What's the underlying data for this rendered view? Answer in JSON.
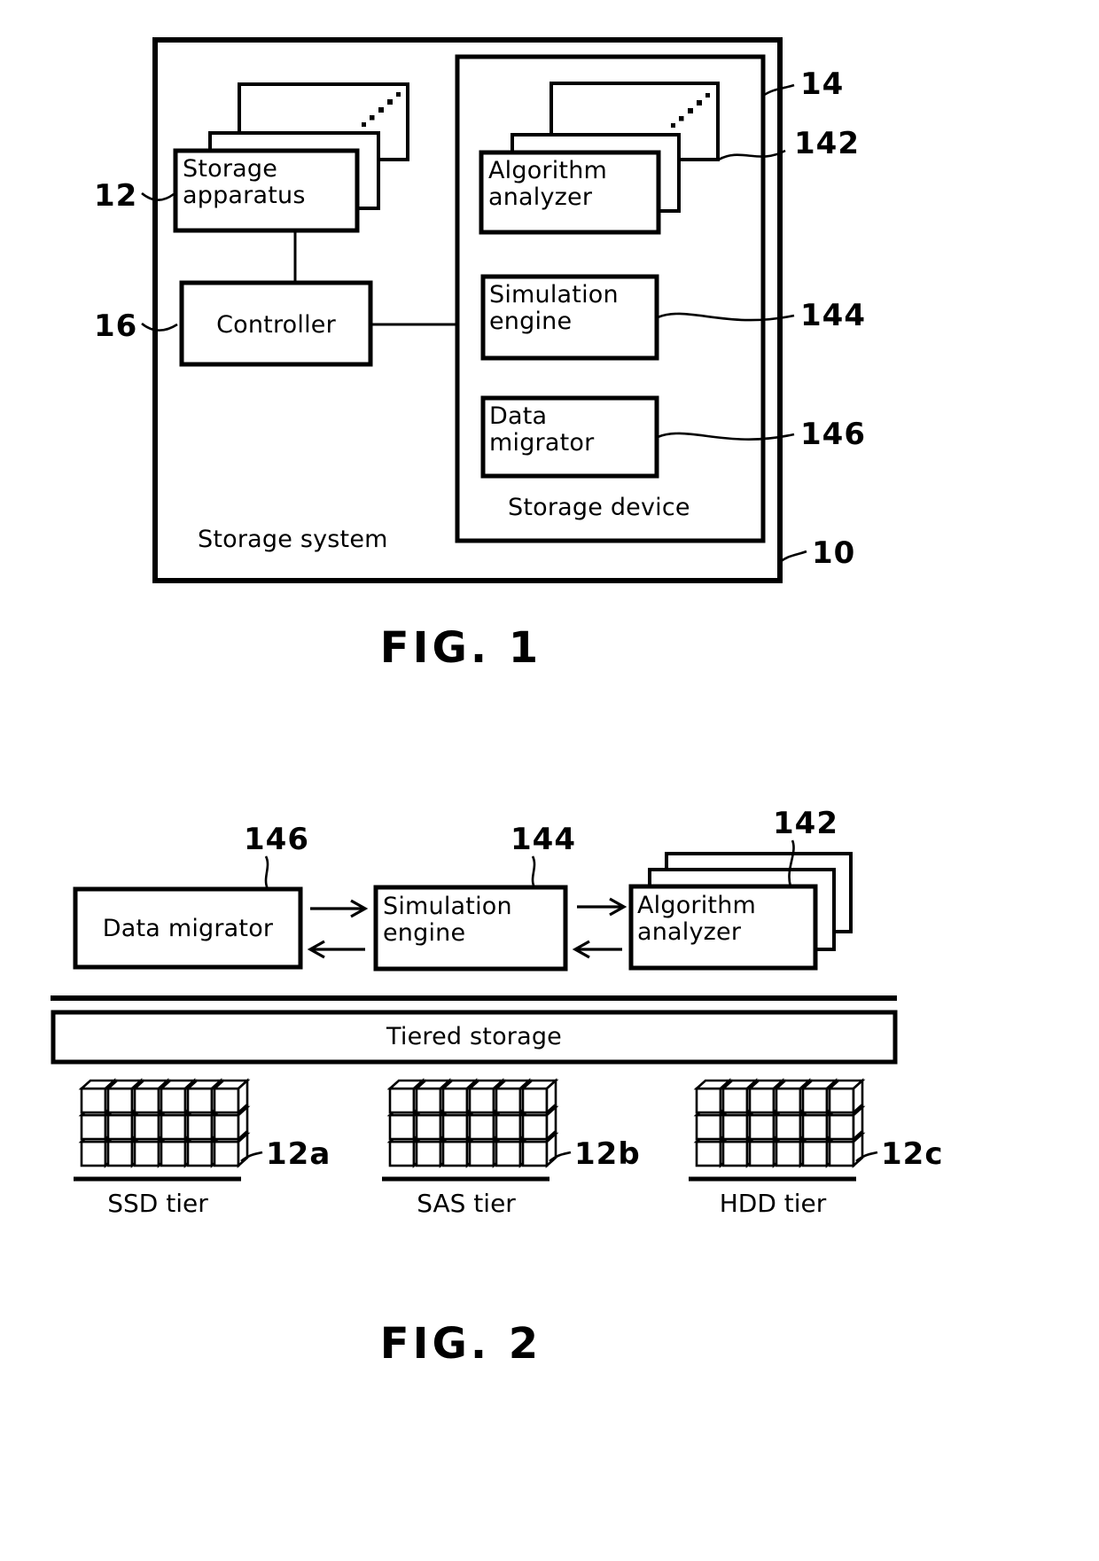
{
  "document": {
    "type": "patent-drawing-sheet",
    "figures": [
      "FIG. 1",
      "FIG. 2"
    ]
  },
  "fig1": {
    "title": "FIG. 1",
    "outer_label": "Storage system",
    "outer_ref": "10",
    "inner_label": "Storage device",
    "inner_ref": "14",
    "blocks": [
      {
        "id": "storage-apparatus",
        "label": "Storage\napparatus",
        "ref": "12",
        "stacked": true,
        "dots": true
      },
      {
        "id": "controller",
        "label": "Controller",
        "ref": "16",
        "stacked": false,
        "dots": false
      },
      {
        "id": "algorithm-analyzer",
        "label": "Algorithm\nanalyzer",
        "ref": "142",
        "stacked": true,
        "dots": true
      },
      {
        "id": "simulation-engine",
        "label": "Simulation\nengine",
        "ref": "144",
        "stacked": false,
        "dots": false
      },
      {
        "id": "data-migrator",
        "label": "Data\nmigrator",
        "ref": "146",
        "stacked": false,
        "dots": false
      }
    ],
    "refs": {
      "r10": "10",
      "r12": "12",
      "r14": "14",
      "r16": "16",
      "r142": "142",
      "r144": "144",
      "r146": "146"
    }
  },
  "fig2": {
    "title": "FIG. 2",
    "blocks": [
      {
        "id": "data-migrator",
        "label": "Data migrator",
        "ref": "146",
        "stacked": false
      },
      {
        "id": "simulation-engine",
        "label": "Simulation\nengine",
        "ref": "144",
        "stacked": false
      },
      {
        "id": "algorithm-analyzer",
        "label": "Algorithm\nanalyzer",
        "ref": "142",
        "stacked": true
      }
    ],
    "tiered_storage_label": "Tiered storage",
    "tiers": [
      {
        "id": "ssd",
        "label": "SSD tier",
        "ref": "12a"
      },
      {
        "id": "sas",
        "label": "SAS tier",
        "ref": "12b"
      },
      {
        "id": "hdd",
        "label": "HDD tier",
        "ref": "12c"
      }
    ],
    "arrows": [
      {
        "from": "data-migrator",
        "to": "simulation-engine",
        "direction": "right"
      },
      {
        "from": "simulation-engine",
        "to": "data-migrator",
        "direction": "left"
      },
      {
        "from": "simulation-engine",
        "to": "algorithm-analyzer",
        "direction": "right"
      },
      {
        "from": "algorithm-analyzer",
        "to": "simulation-engine",
        "direction": "left"
      }
    ],
    "refs": {
      "r142": "142",
      "r144": "144",
      "r146": "146",
      "r12a": "12a",
      "r12b": "12b",
      "r12c": "12c"
    }
  },
  "colors": {
    "ink": "#000000",
    "paper": "#ffffff"
  }
}
